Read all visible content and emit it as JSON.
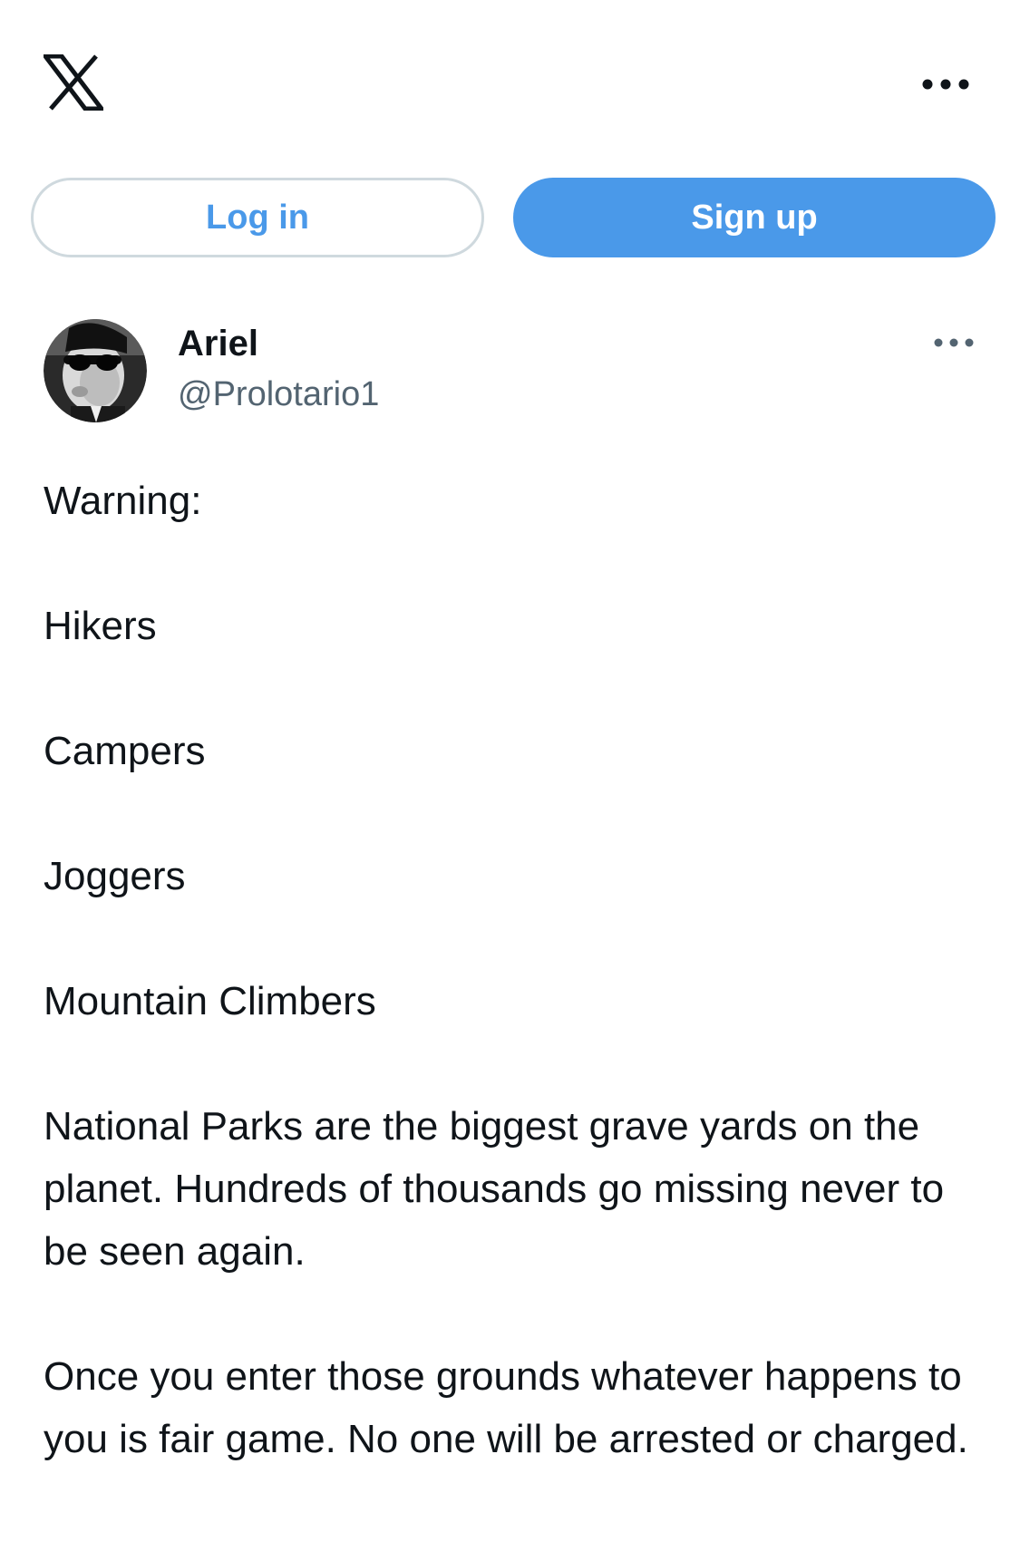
{
  "header": {
    "logo_icon": "x-logo-icon",
    "more_icon": "more-horizontal-icon"
  },
  "auth": {
    "login_label": "Log in",
    "signup_label": "Sign up"
  },
  "post": {
    "author": {
      "name": "Ariel",
      "handle": "@Prolotario1",
      "avatar_icon": "user-avatar"
    },
    "more_icon": "more-horizontal-icon",
    "paragraphs": [
      "Warning:",
      "Hikers",
      "Campers",
      "Joggers",
      "Mountain Climbers",
      "National Parks are the biggest grave yards on the planet. Hundreds of thousands go missing never to be seen again.",
      "Once you enter those grounds whatever happens to you is fair game. No one will be arrested or charged."
    ]
  },
  "colors": {
    "accent": "#4a99e9",
    "text": "#0f1419",
    "secondary_text": "#536471",
    "border": "#cfd9de"
  }
}
